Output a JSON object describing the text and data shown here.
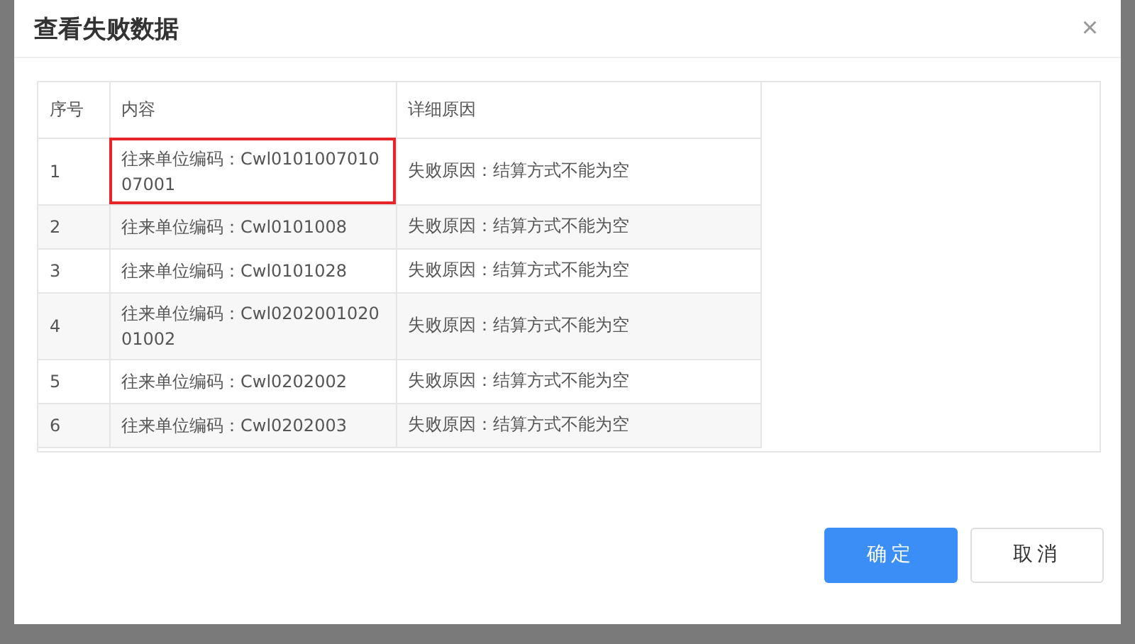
{
  "dialog": {
    "title": "查看失败数据",
    "close": "×"
  },
  "table": {
    "columns": [
      "序号",
      "内容",
      "详细原因"
    ],
    "rows": [
      {
        "cells": [
          "1",
          "往来单位编码：Cwl010100701007001",
          "失败原因：结算方式不能为空"
        ],
        "highlighted": true
      },
      {
        "cells": [
          "2",
          "往来单位编码：Cwl0101008",
          "失败原因：结算方式不能为空"
        ],
        "highlighted": false
      },
      {
        "cells": [
          "3",
          "往来单位编码：Cwl0101028",
          "失败原因：结算方式不能为空"
        ],
        "highlighted": false
      },
      {
        "cells": [
          "4",
          "往来单位编码：Cwl020200102001002",
          "失败原因：结算方式不能为空"
        ],
        "highlighted": false
      },
      {
        "cells": [
          "5",
          "往来单位编码：Cwl0202002",
          "失败原因：结算方式不能为空"
        ],
        "highlighted": false
      },
      {
        "cells": [
          "6",
          "往来单位编码：Cwl0202003",
          "失败原因：结算方式不能为空"
        ],
        "highlighted": false
      }
    ]
  },
  "buttons": [
    {
      "label": "确定",
      "kind": "primary"
    },
    {
      "label": "取消",
      "kind": "default"
    }
  ]
}
